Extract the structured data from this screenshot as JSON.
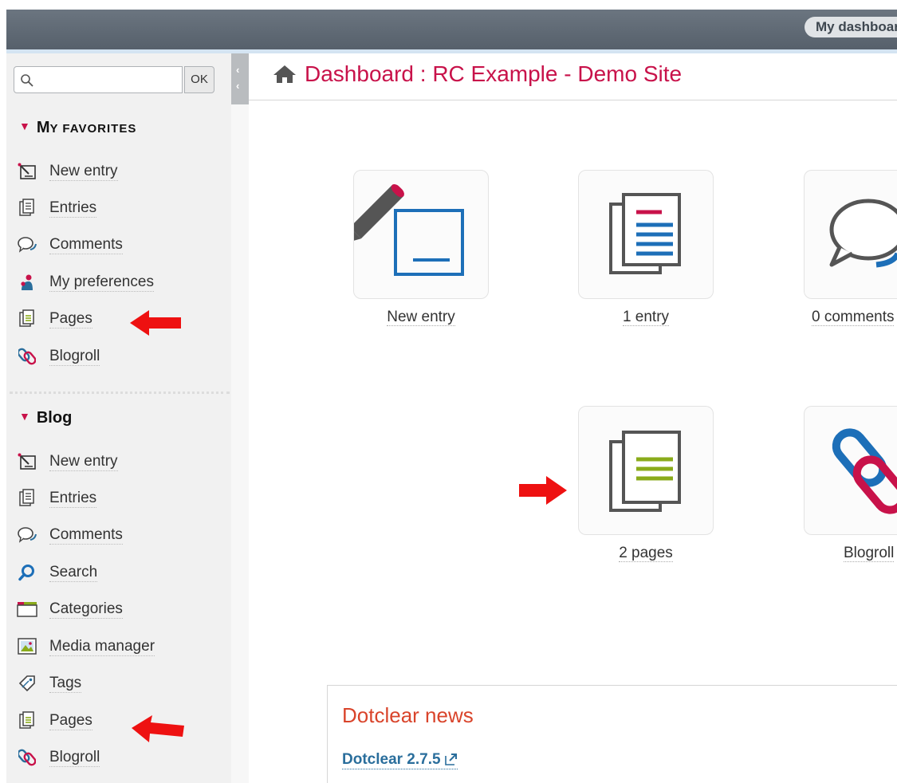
{
  "header": {
    "dashboard_button": "My dashboard"
  },
  "search": {
    "placeholder": "",
    "button_label": "OK"
  },
  "favorites": {
    "title_first": "M",
    "title_rest": "y favorites",
    "items": [
      {
        "label": "New entry",
        "icon": "new-entry-icon"
      },
      {
        "label": "Entries",
        "icon": "entries-icon"
      },
      {
        "label": "Comments",
        "icon": "comments-icon"
      },
      {
        "label": "My preferences",
        "icon": "preferences-icon"
      },
      {
        "label": "Pages",
        "icon": "pages-icon"
      },
      {
        "label": "Blogroll",
        "icon": "blogroll-icon"
      }
    ]
  },
  "blog": {
    "title": "Blog",
    "items": [
      {
        "label": "New entry",
        "icon": "new-entry-icon"
      },
      {
        "label": "Entries",
        "icon": "entries-icon"
      },
      {
        "label": "Comments",
        "icon": "comments-icon"
      },
      {
        "label": "Search",
        "icon": "search-icon"
      },
      {
        "label": "Categories",
        "icon": "categories-icon"
      },
      {
        "label": "Media manager",
        "icon": "media-icon"
      },
      {
        "label": "Tags",
        "icon": "tags-icon"
      },
      {
        "label": "Pages",
        "icon": "pages-icon"
      },
      {
        "label": "Blogroll",
        "icon": "blogroll-icon"
      }
    ]
  },
  "main": {
    "title": "Dashboard : RC Example - Demo Site",
    "tiles": [
      {
        "label": "New entry"
      },
      {
        "label": "1 entry"
      },
      {
        "label": "0 comments"
      },
      {
        "label": "2 pages"
      },
      {
        "label": "Blogroll"
      }
    ]
  },
  "news": {
    "title": "Dotclear news",
    "link": "Dotclear 2.7.5"
  },
  "colors": {
    "accent": "#c8124a",
    "news_title": "#d9442b",
    "link": "#2a6e9c",
    "annotation_arrow": "#ee1111"
  }
}
